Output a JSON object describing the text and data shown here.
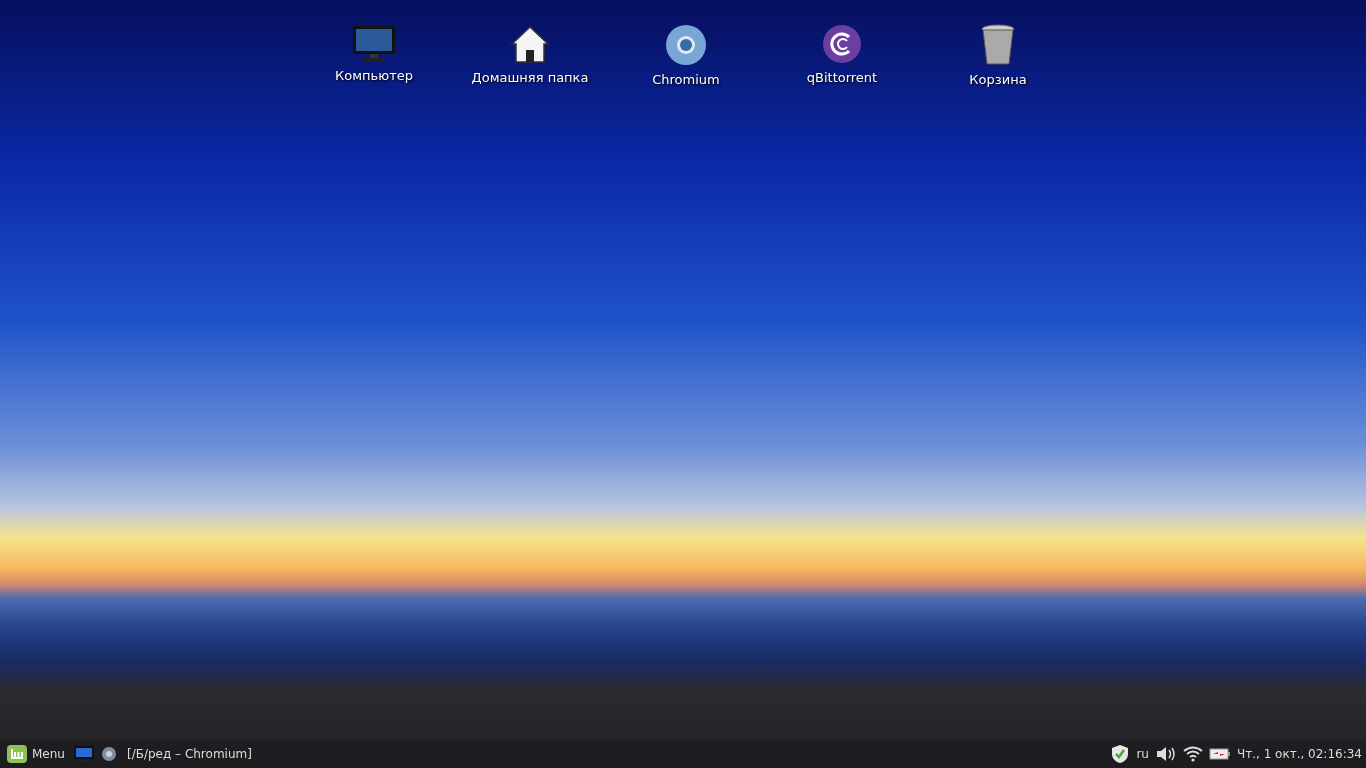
{
  "desktop_icons": [
    {
      "kind": "computer",
      "label": "Компьютер"
    },
    {
      "kind": "home",
      "label": "Домашняя папка"
    },
    {
      "kind": "browser",
      "label": "Chromium"
    },
    {
      "kind": "torrent",
      "label": "qBittorrent"
    },
    {
      "kind": "trash",
      "label": "Корзина"
    }
  ],
  "taskbar": {
    "menu_label": "Menu",
    "window_buttons": [
      {
        "title": "[/Б/ред – Chromium]"
      }
    ],
    "keyboard_layout": "ru",
    "clock": "Чт., 1 окт., 02:16:34"
  }
}
